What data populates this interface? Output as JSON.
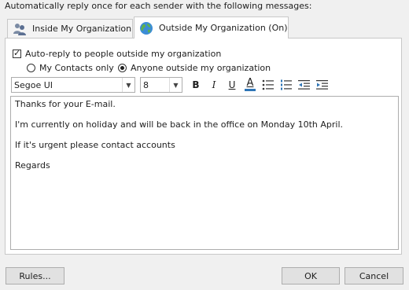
{
  "header": {
    "text": "Automatically reply once for each sender with the following messages:"
  },
  "tabs": [
    {
      "label": "Inside My Organization",
      "icon": "people-icon",
      "selected": false
    },
    {
      "label": "Outside My Organization (On)",
      "icon": "globe-icon",
      "selected": true
    }
  ],
  "options": {
    "auto_reply_label": "Auto-reply to people outside my organization",
    "auto_reply_checked": true,
    "radio_contacts_label": "My Contacts only",
    "radio_anyone_label": "Anyone outside my organization",
    "selected_audience": "Anyone outside my organization"
  },
  "toolbar": {
    "font": "Segoe UI",
    "size": "8",
    "buttons": [
      "bold-icon",
      "italic-icon",
      "underline-icon",
      "font-color-icon",
      "bullets-icon",
      "numbering-icon",
      "decrease-indent-icon",
      "increase-indent-icon"
    ],
    "bold_glyph": "B",
    "italic_glyph": "I",
    "underline_glyph": "U",
    "font_color_glyph": "A",
    "font_color": "#2e75b6"
  },
  "message": {
    "lines": [
      "Thanks for your E-mail.",
      "I'm currently on holiday and will be back in the office on Monday 10th April.",
      "If it's urgent please contact accounts",
      "Regards"
    ]
  },
  "footer": {
    "rules_label": "Rules...",
    "ok_label": "OK",
    "cancel_label": "Cancel"
  }
}
